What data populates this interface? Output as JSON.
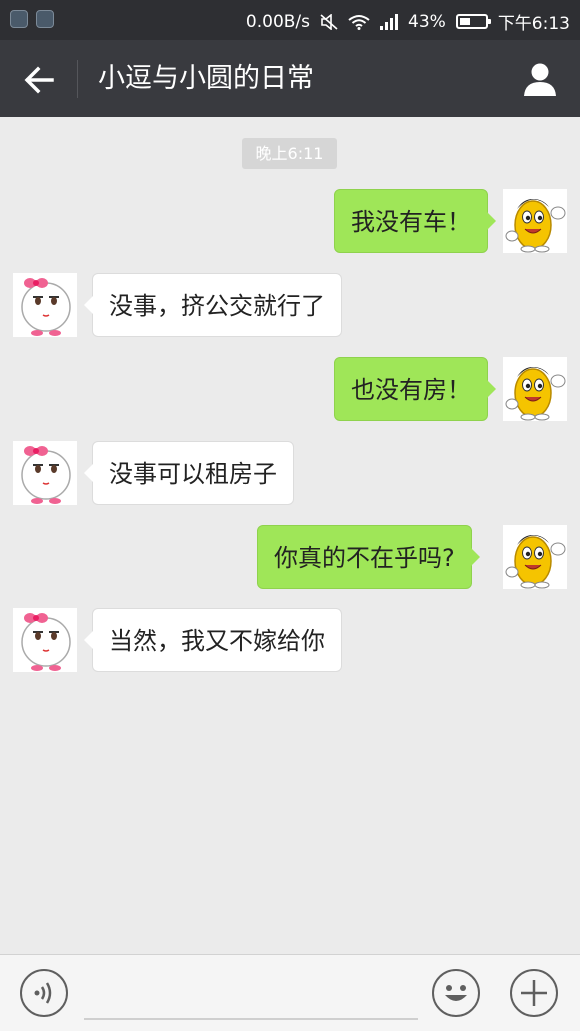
{
  "status_bar": {
    "net_speed": "0.00B/s",
    "battery_pct": "43%",
    "battery_level": 0.43,
    "time": "下午6:13",
    "icons": [
      "app-icon-1",
      "app-icon-2",
      "mute-icon",
      "wifi-icon",
      "signal-icon",
      "battery-icon"
    ]
  },
  "header": {
    "title": "小逗与小圆的日常",
    "back_icon": "back-arrow-icon",
    "profile_icon": "person-icon"
  },
  "chat": {
    "time_label": "晚上6:11",
    "messages": [
      {
        "side": "right",
        "text": "我没有车！",
        "avatar": "yellow-bean-avatar"
      },
      {
        "side": "left",
        "text": "没事，挤公交就行了",
        "avatar": "white-bow-avatar"
      },
      {
        "side": "right",
        "text": "也没有房！",
        "avatar": "yellow-bean-avatar"
      },
      {
        "side": "left",
        "text": "没事可以租房子",
        "avatar": "white-bow-avatar"
      },
      {
        "side": "right",
        "text": "你真的不在乎吗?",
        "avatar": "yellow-bean-avatar"
      },
      {
        "side": "left",
        "text": "当然，我又不嫁给你",
        "avatar": "white-bow-avatar"
      }
    ]
  },
  "input_bar": {
    "voice_icon": "voice-icon",
    "emoji_icon": "emoji-icon",
    "plus_icon": "plus-icon"
  },
  "colors": {
    "status_bg": "#2e2f33",
    "header_bg": "#393a3f",
    "chat_bg": "#ebebeb",
    "bubble_sent": "#9fe658",
    "bubble_received": "#ffffff"
  }
}
